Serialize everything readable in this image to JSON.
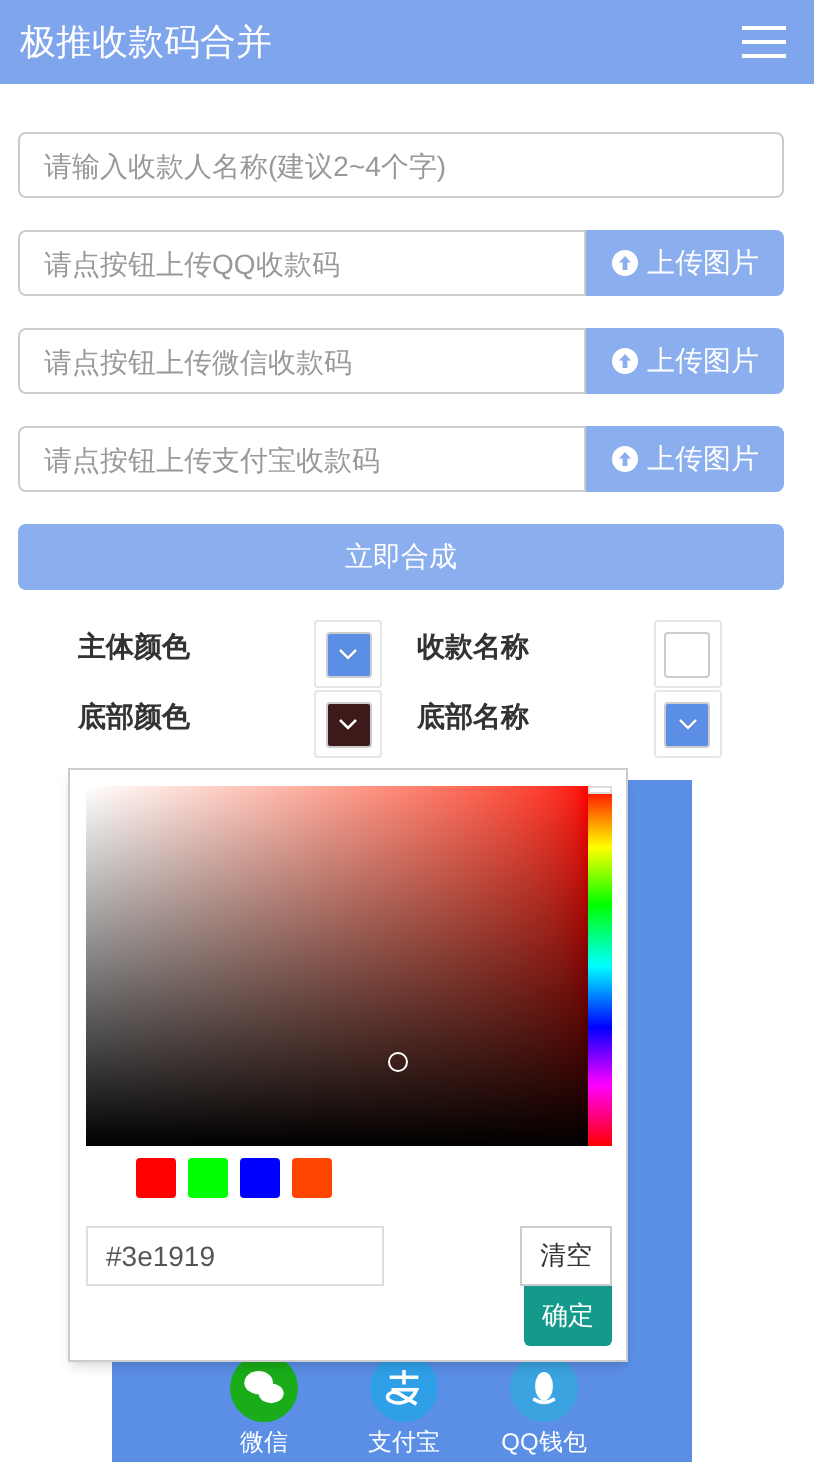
{
  "header": {
    "title": "极推收款码合并"
  },
  "fields": [
    {
      "kind": "text",
      "placeholder": "请输入收款人名称(建议2~4个字)"
    },
    {
      "kind": "upload",
      "placeholder": "请点按钮上传QQ收款码",
      "button": "上传图片"
    },
    {
      "kind": "upload",
      "placeholder": "请点按钮上传微信收款码",
      "button": "上传图片"
    },
    {
      "kind": "upload",
      "placeholder": "请点按钮上传支付宝收款码",
      "button": "上传图片"
    }
  ],
  "submit": "立即合成",
  "options": [
    {
      "label": "主体颜色",
      "color": "#5b8fe6",
      "arrow": true
    },
    {
      "label": "收款名称",
      "color": "#ffffff",
      "arrow": false
    },
    {
      "label": "底部颜色",
      "color": "#3e1919",
      "arrow": true
    },
    {
      "label": "底部名称",
      "color": "#5b8fe6",
      "arrow": true
    }
  ],
  "picker": {
    "presets": [
      {
        "color": "#ff0000"
      },
      {
        "color": "#00ff00"
      },
      {
        "color": "#0000ff"
      },
      {
        "color": "#ff4500"
      }
    ],
    "hue": {
      "level": 0
    },
    "value": "#3e1919",
    "clear": "清空",
    "confirm": "确定"
  },
  "preview": {
    "color": "#5b8fe6",
    "items": [
      {
        "kind": "wechat",
        "label": "微信"
      },
      {
        "kind": "alipay",
        "label": "支付宝"
      },
      {
        "kind": "qq",
        "label": "QQ钱包"
      }
    ]
  }
}
